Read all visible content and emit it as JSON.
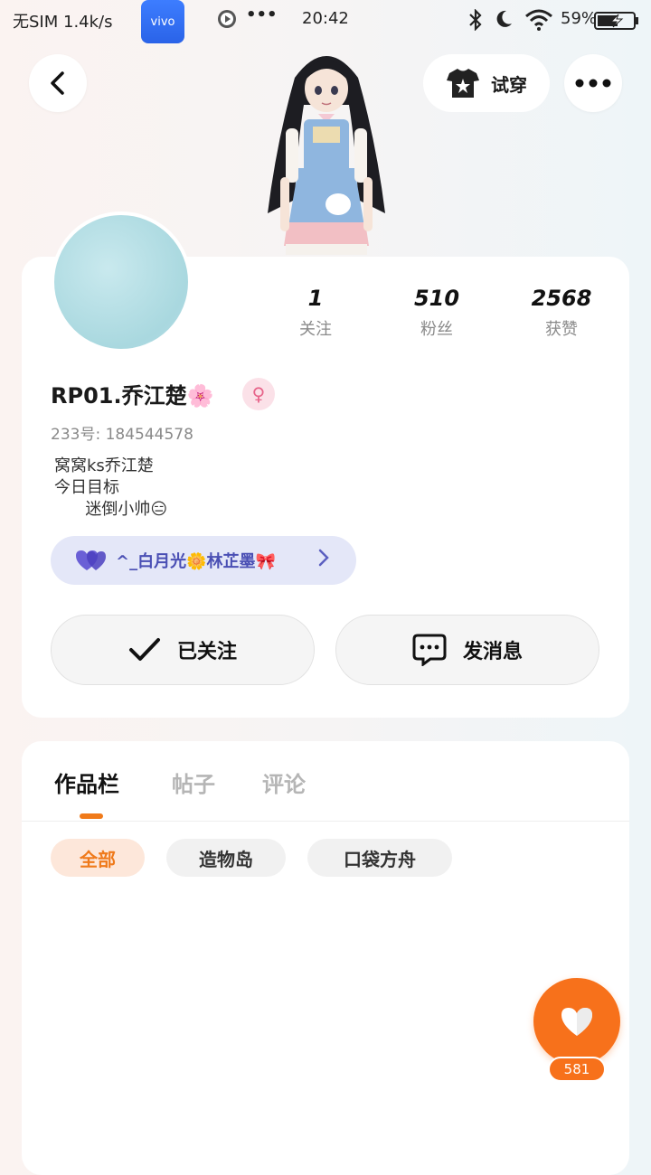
{
  "status_bar": {
    "carrier": "无SIM 1.4k/s",
    "app_badge": "vivo",
    "dots": "•••",
    "time": "20:42",
    "battery": "59%"
  },
  "header": {
    "try_on_label": "试穿"
  },
  "profile": {
    "username": "RP01.乔江楚🌸",
    "gender_symbol": "♀",
    "uid": "233号: 184544578",
    "bio": "窝窝ks乔江楚\n今日目标\n      迷倒小帅😑",
    "stats": [
      {
        "value": "1",
        "label": "关注"
      },
      {
        "value": "510",
        "label": "粉丝"
      },
      {
        "value": "2568",
        "label": "获赞"
      }
    ],
    "guild": "^_白月光🌼林芷墨🎀",
    "follow_button": "已关注",
    "message_button": "发消息"
  },
  "tabs": [
    {
      "label": "作品栏",
      "active": true
    },
    {
      "label": "帖子",
      "active": false
    },
    {
      "label": "评论",
      "active": false
    }
  ],
  "filter_chips": [
    {
      "label": "全部",
      "active": true
    },
    {
      "label": "造物岛",
      "active": false
    },
    {
      "label": "口袋方舟",
      "active": false
    }
  ],
  "like_fab": {
    "count": "581"
  },
  "colors": {
    "accent": "#f7711b",
    "guild_bg": "#e4e7f8",
    "guild_text": "#4a4fb4"
  }
}
